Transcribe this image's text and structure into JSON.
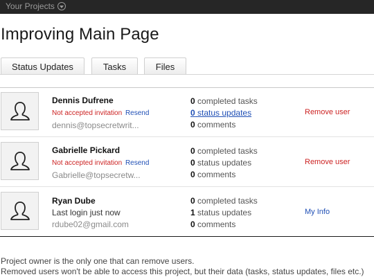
{
  "topbar": {
    "projects_label": "Your Projects"
  },
  "page": {
    "title": "Improving Main Page"
  },
  "tabs": [
    {
      "label": "Status Updates"
    },
    {
      "label": "Tasks"
    },
    {
      "label": "Files"
    }
  ],
  "users": [
    {
      "name": "Dennis Dufrene",
      "status_text": "Not accepted invitation",
      "resend_label": "Resend",
      "email": "dennis@topsecretwrit...",
      "tasks_count": "0",
      "tasks_label": "completed tasks",
      "updates_count": "0",
      "updates_label": "status updates",
      "comments_count": "0",
      "comments_label": "comments",
      "action_label": "Remove user"
    },
    {
      "name": "Gabrielle Pickard",
      "status_text": "Not accepted invitation",
      "resend_label": "Resend",
      "email": "Gabrielle@topsecretw...",
      "tasks_count": "0",
      "tasks_label": "completed tasks",
      "updates_count": "0",
      "updates_label": "status updates",
      "comments_count": "0",
      "comments_label": "comments",
      "action_label": "Remove user"
    },
    {
      "name": "Ryan Dube",
      "status_text": "Last login just now",
      "email": "rdube02@gmail.com",
      "tasks_count": "0",
      "tasks_label": "completed tasks",
      "updates_count": "1",
      "updates_label": "status updates",
      "comments_count": "0",
      "comments_label": "comments",
      "action_label": "My Info"
    }
  ],
  "footer": {
    "note1": "Project owner is the only one that can remove users.",
    "note2": "Removed users won't be able to access this project, but their data (tasks, status updates, files etc.)"
  },
  "colors": {
    "topbar": "#262626",
    "danger": "#cc2222",
    "link": "#1f4fb5"
  }
}
